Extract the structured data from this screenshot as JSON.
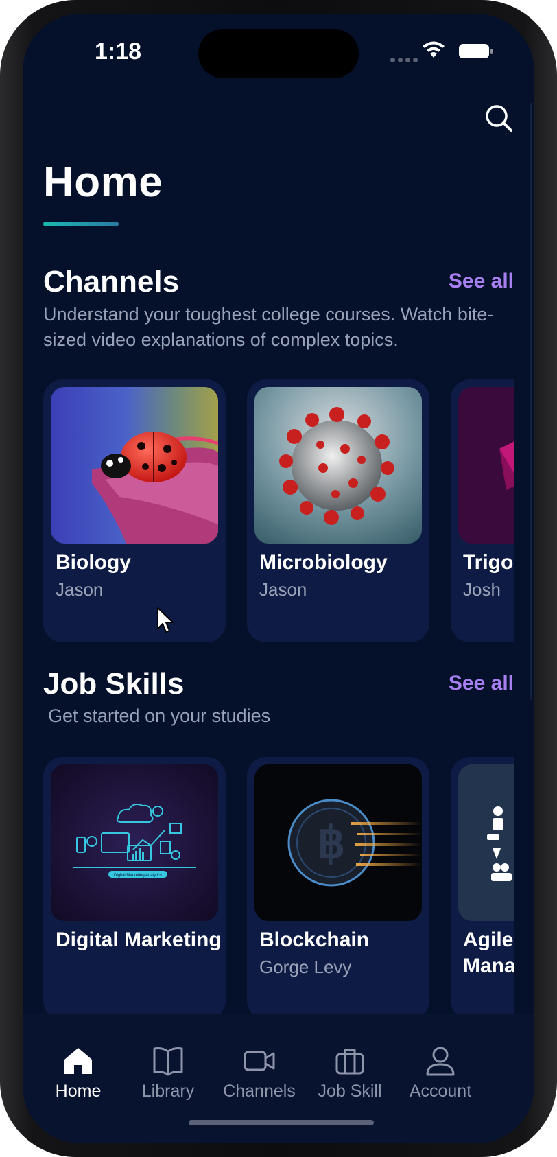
{
  "status_bar": {
    "time": "1:18"
  },
  "header": {
    "title": "Home",
    "search_icon": "search-icon"
  },
  "channels": {
    "title": "Channels",
    "see_all": "See all",
    "description": "Understand your toughest college courses. Watch bite-sized video explanations of complex topics.",
    "cards": [
      {
        "title": "Biology",
        "author": "Jason"
      },
      {
        "title": "Microbiology",
        "author": "Jason"
      },
      {
        "title": "Trigonometry",
        "author": "Josh"
      }
    ]
  },
  "job_skills": {
    "title": "Job Skills",
    "see_all": "See all",
    "description": "Get started on your studies",
    "cards": [
      {
        "title": "Digital Marketing",
        "author": "",
        "thumb_caption": "Digital Marketing Analytics"
      },
      {
        "title": "Blockchain",
        "author": "Gorge Levy"
      },
      {
        "title": "Agile Management",
        "author": ""
      }
    ]
  },
  "tab_bar": {
    "items": [
      {
        "label": "Home",
        "icon": "home-icon",
        "active": true
      },
      {
        "label": "Library",
        "icon": "book-icon",
        "active": false
      },
      {
        "label": "Channels",
        "icon": "video-camera-icon",
        "active": false
      },
      {
        "label": "Job Skill",
        "icon": "briefcase-icon",
        "active": false
      },
      {
        "label": "Account",
        "icon": "user-icon",
        "active": false
      }
    ]
  },
  "colors": {
    "background": "#05112b",
    "card": "#0e1c45",
    "accent_link": "#a77ff0",
    "underline": "#1cb8b0",
    "muted_text": "#9aa2b8"
  }
}
